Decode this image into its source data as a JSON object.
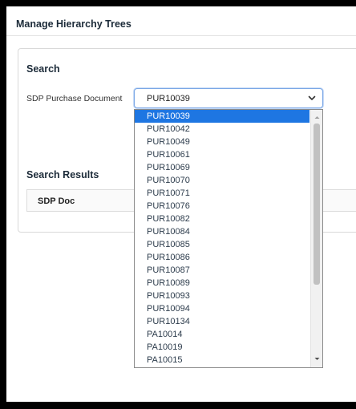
{
  "page": {
    "title": "Manage Hierarchy Trees"
  },
  "search": {
    "heading": "Search",
    "field_label": "SDP Purchase Document",
    "selected_value": "PUR10039"
  },
  "dropdown": {
    "options": [
      "PUR10039",
      "PUR10042",
      "PUR10049",
      "PUR10061",
      "PUR10069",
      "PUR10070",
      "PUR10071",
      "PUR10076",
      "PUR10082",
      "PUR10084",
      "PUR10085",
      "PUR10086",
      "PUR10087",
      "PUR10089",
      "PUR10093",
      "PUR10094",
      "PUR10134",
      "PA10014",
      "PA10019",
      "PA10015"
    ],
    "selected_index": 0
  },
  "results": {
    "heading": "Search Results",
    "columns": [
      "SDP Doc"
    ]
  },
  "colors": {
    "selected_option_bg": "#1e76e2",
    "select_focus_border": "#7aa7e6"
  },
  "icons": {
    "select_chevron": "chevron-down-icon",
    "scroll_up": "scroll-up-arrow-icon",
    "scroll_down": "scroll-down-arrow-icon"
  }
}
